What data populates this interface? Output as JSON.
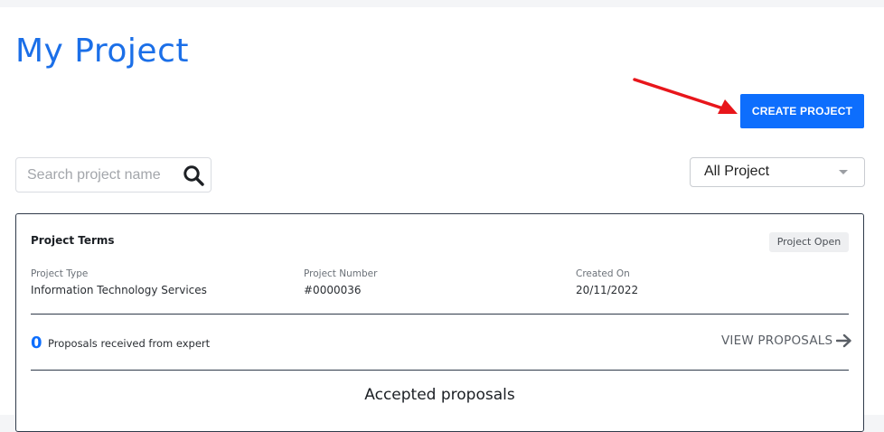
{
  "header": {
    "title": "My Project"
  },
  "actions": {
    "create_label": "CREATE PROJECT"
  },
  "search": {
    "placeholder": "Search project name",
    "value": ""
  },
  "filter": {
    "selected": "All Project"
  },
  "project_card": {
    "title": "Project Terms",
    "status": "Project Open",
    "fields": [
      {
        "label": "Project Type",
        "value": "Information Technology Services"
      },
      {
        "label": "Project Number",
        "value": "#0000036"
      },
      {
        "label": "Created On",
        "value": "20/11/2022"
      }
    ],
    "proposals_count": "0",
    "proposals_text": "Proposals received from expert",
    "view_label": "VIEW PROPOSALS",
    "accepted_title": "Accepted proposals"
  },
  "colors": {
    "accent": "#0d6efd",
    "title": "#1b6fe8",
    "annotation_arrow": "#e8161b"
  },
  "icons": [
    "search-icon",
    "chevron-down-icon",
    "arrow-right-icon",
    "annotation-arrow"
  ]
}
